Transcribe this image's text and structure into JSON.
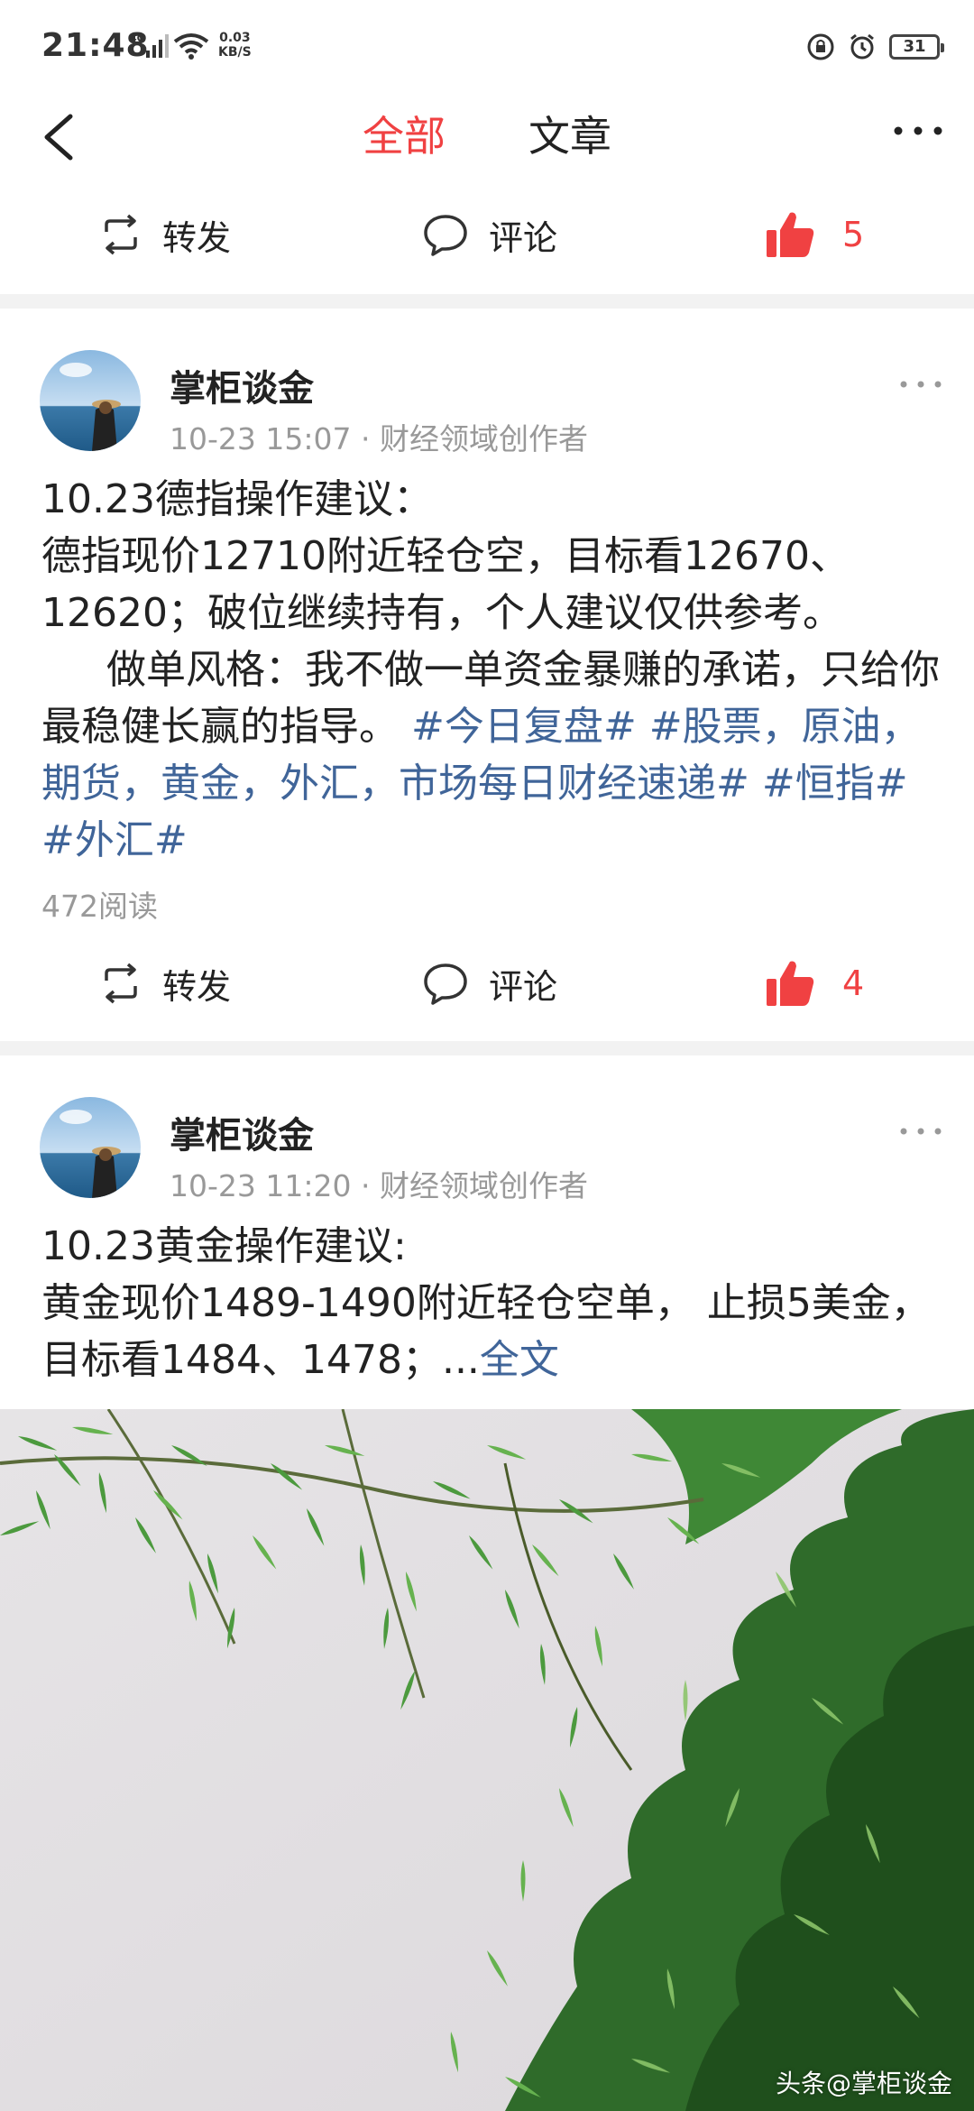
{
  "status_bar": {
    "time": "21:48",
    "network": "4G",
    "speed_value": "0.03",
    "speed_unit": "KB/S",
    "battery": "31"
  },
  "nav": {
    "tabs": [
      {
        "label": "全部",
        "active": true
      },
      {
        "label": "文章",
        "active": false
      }
    ],
    "icons": {
      "back": "back-arrow-icon",
      "more": "more-dots-icon"
    }
  },
  "top_actions": {
    "share_label": "转发",
    "comment_label": "评论",
    "like_count": "5"
  },
  "posts": [
    {
      "author": "掌柜谈金",
      "time": "10-23 15:07",
      "role": "财经领域创作者",
      "line1": "10.23德指操作建议：",
      "line2": "德指现价12710附近轻仓空，目标看12670、12620；破位继续持有，个人建议仅供参考。",
      "line3": "做单风格：我不做一单资金暴赚的承诺，只给你最稳健长赢的指导。",
      "hashtag1": "#今日复盘#",
      "hashtag2": "#股票，原油，期货，黄金，外汇，市场每日财经速递#",
      "hashtag3": "#恒指#",
      "hashtag4": "#外汇#",
      "reads": "472阅读",
      "share_label": "转发",
      "comment_label": "评论",
      "like_count": "4"
    },
    {
      "author": "掌柜谈金",
      "time": "10-23 11:20",
      "role": "财经领域创作者",
      "line1": "10.23黄金操作建议:",
      "line2": "黄金现价1489-1490附近轻仓空单， 止损5美金，目标看1484、1478；...",
      "full_text_link": "全文",
      "watermark": "头条@掌柜谈金"
    }
  ],
  "colors": {
    "accent": "#f04142",
    "link": "#406599",
    "meta": "#999999",
    "separator": "#f2f2f2"
  }
}
